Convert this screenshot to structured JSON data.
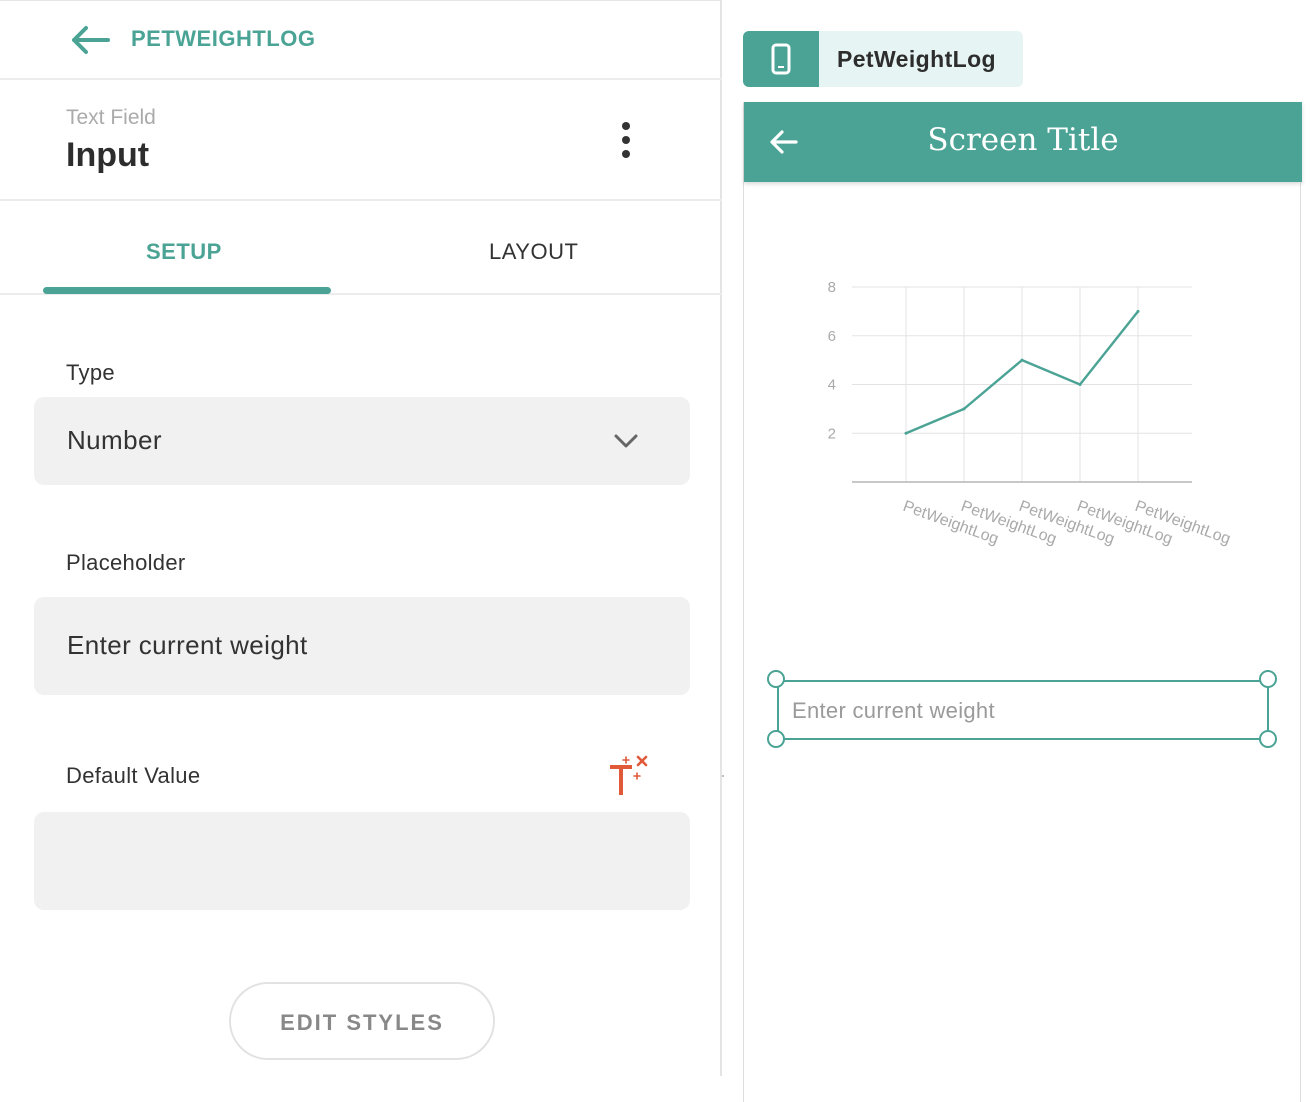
{
  "header": {
    "back_label": "PETWEIGHTLOG"
  },
  "component": {
    "type_label": "Text Field",
    "name": "Input"
  },
  "tabs": [
    {
      "label": "SETUP",
      "active": true
    },
    {
      "label": "LAYOUT",
      "active": false
    }
  ],
  "fields": {
    "type": {
      "label": "Type",
      "value": "Number"
    },
    "placeholder": {
      "label": "Placeholder",
      "value": "Enter current weight"
    },
    "default_value": {
      "label": "Default Value",
      "value": ""
    }
  },
  "edit_styles_label": "EDIT STYLES",
  "preview": {
    "screen_name": "PetWeightLog",
    "screen_title": "Screen Title",
    "input_placeholder": "Enter current weight"
  },
  "colors": {
    "accent": "#4aa394",
    "magic_icon": "#e05a3a"
  },
  "icons": {
    "back": "arrow-left-icon",
    "more": "kebab-menu-icon",
    "dropdown": "chevron-down-icon",
    "magic_text": "magic-text-icon",
    "device": "phone-icon"
  },
  "chart_data": {
    "type": "line",
    "categories": [
      "PetWeightLog",
      "PetWeightLog",
      "PetWeightLog",
      "PetWeightLog",
      "PetWeightLog"
    ],
    "values": [
      2,
      3,
      5,
      4,
      7
    ],
    "yticks": [
      2,
      4,
      6,
      8
    ],
    "ylim": [
      0,
      8
    ],
    "grid": true,
    "color": "#4aa394"
  }
}
